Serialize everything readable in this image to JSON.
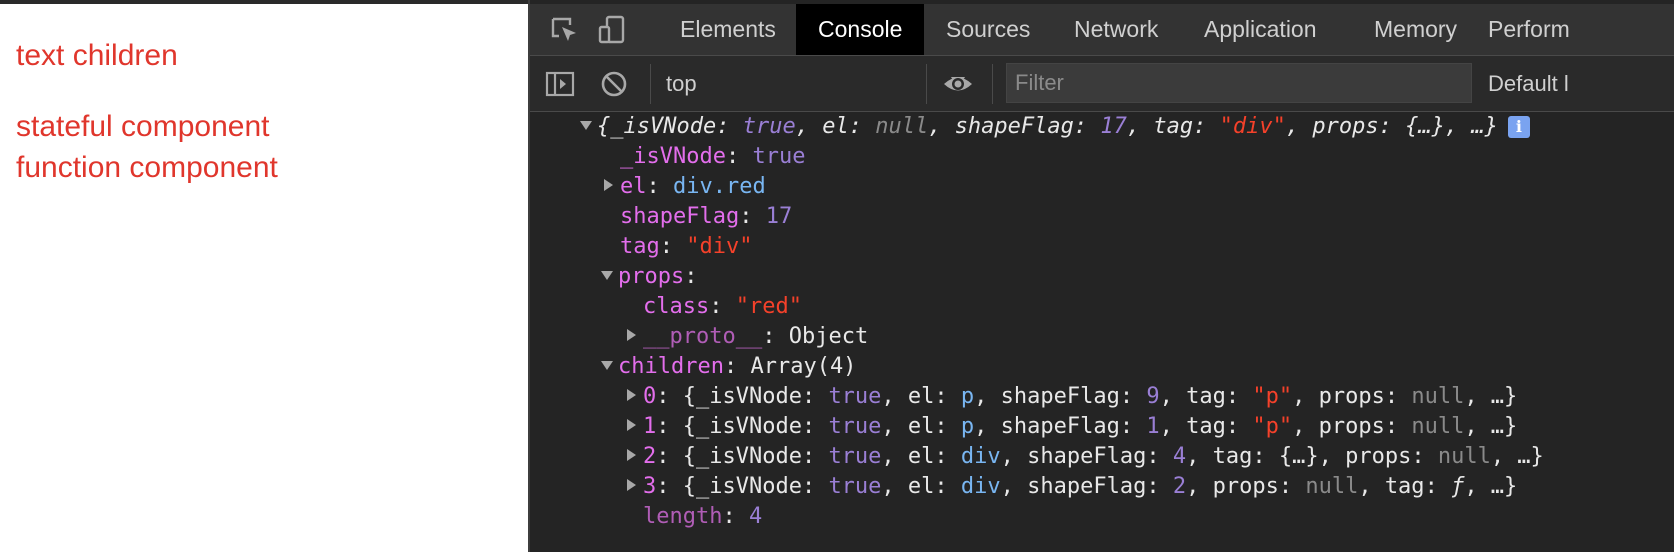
{
  "page": {
    "lines": [
      "text children",
      "stateful component",
      "function component"
    ]
  },
  "devtools": {
    "tabs": [
      "Elements",
      "Console",
      "Sources",
      "Network",
      "Application",
      "Memory",
      "Perform"
    ],
    "active_tab": "Console",
    "toolbar": {
      "context": "top",
      "filter_placeholder": "Filter",
      "levels": "Default l"
    },
    "icons": [
      "inspect-element-icon",
      "device-toolbar-icon",
      "sidebar-toggle-icon",
      "clear-console-icon",
      "dropdown-arrow-icon",
      "live-expression-eye-icon",
      "expand-triangle-icon",
      "collapse-triangle-icon",
      "info-icon"
    ],
    "colors": {
      "page_text": "#e0362c",
      "key": "#e36eec",
      "string": "#f5412a",
      "number_bool": "#9a7fd5",
      "node": "#79b6f2",
      "null": "#8a8a8a"
    }
  },
  "console": {
    "summary": {
      "isVNode_key": "_isVNode",
      "isVNode_val": "true",
      "el_key": "el",
      "el_val": "null",
      "shapeFlag_key": "shapeFlag",
      "shapeFlag_val": "17",
      "tag_key": "tag",
      "tag_val": "\"div\"",
      "props_key": "props",
      "props_val": "{…}",
      "more": "…",
      "info": "i"
    },
    "isVNode": {
      "key": "_isVNode",
      "value": "true"
    },
    "el": {
      "key": "el",
      "value": "div.red"
    },
    "shapeFlag": {
      "key": "shapeFlag",
      "value": "17"
    },
    "tag": {
      "key": "tag",
      "value": "\"div\""
    },
    "props": {
      "key": "props",
      "class_key": "class",
      "class_val": "\"red\"",
      "proto_key": "__proto__",
      "proto_val": "Object"
    },
    "children": {
      "key": "children",
      "value": "Array(4)",
      "items": [
        {
          "index": "0",
          "isVNode": "true",
          "el": "p",
          "shapeFlag": "9",
          "k3": "tag",
          "v3": "\"p\"",
          "k4": "props",
          "v4": "null"
        },
        {
          "index": "1",
          "isVNode": "true",
          "el": "p",
          "shapeFlag": "1",
          "k3": "tag",
          "v3": "\"p\"",
          "k4": "props",
          "v4": "null"
        },
        {
          "index": "2",
          "isVNode": "true",
          "el": "div",
          "shapeFlag": "4",
          "k3": "tag",
          "v3": "{…}",
          "k4": "props",
          "v4": "null"
        },
        {
          "index": "3",
          "isVNode": "true",
          "el": "div",
          "shapeFlag": "2",
          "k3": "props",
          "v3": "null",
          "k4": "tag",
          "v4": "ƒ"
        }
      ],
      "length_key": "length",
      "length_val": "4"
    }
  }
}
